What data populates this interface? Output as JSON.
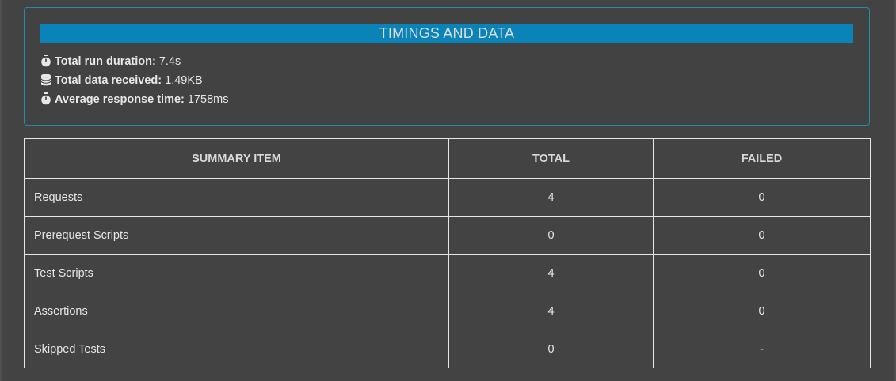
{
  "timings": {
    "title": "TIMINGS AND DATA",
    "run_duration": {
      "icon": "stopwatch-icon",
      "label": "Total run duration:",
      "value": "7.4s"
    },
    "data_received": {
      "icon": "database-icon",
      "label": "Total data received:",
      "value": "1.49KB"
    },
    "avg_response": {
      "icon": "stopwatch-icon",
      "label": "Average response time:",
      "value": "1758ms"
    }
  },
  "summary": {
    "headers": [
      "SUMMARY ITEM",
      "TOTAL",
      "FAILED"
    ],
    "rows": [
      {
        "item": "Requests",
        "total": "4",
        "failed": "0"
      },
      {
        "item": "Prerequest Scripts",
        "total": "0",
        "failed": "0"
      },
      {
        "item": "Test Scripts",
        "total": "4",
        "failed": "0"
      },
      {
        "item": "Assertions",
        "total": "4",
        "failed": "0"
      },
      {
        "item": "Skipped Tests",
        "total": "0",
        "failed": "-"
      }
    ]
  },
  "colors": {
    "background": "#434343",
    "header_bar": "#0a84b8",
    "card_border": "#1f8ca8"
  }
}
